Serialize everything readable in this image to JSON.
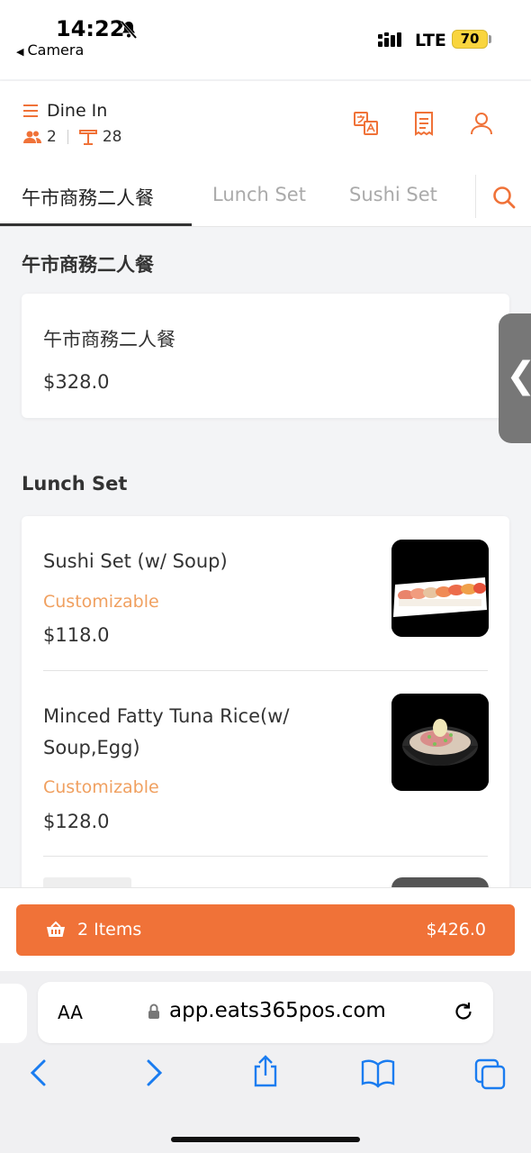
{
  "status_bar": {
    "time": "14:22",
    "back_app": "Camera",
    "network": "LTE",
    "battery": "70"
  },
  "header": {
    "mode": "Dine In",
    "guests": "2",
    "table": "28"
  },
  "tabs": [
    {
      "label": "午市商務二人餐",
      "active": true
    },
    {
      "label": "Lunch Set",
      "active": false
    },
    {
      "label": "Sushi Set",
      "active": false
    }
  ],
  "sections": [
    {
      "title": "午市商務二人餐",
      "items": [
        {
          "name": "午市商務二人餐",
          "price": "$328.0"
        }
      ]
    },
    {
      "title": "Lunch Set",
      "items": [
        {
          "name": "Sushi Set (w/ Soup)",
          "tag": "Customizable",
          "price": "$118.0",
          "image": "sushi-set-photo"
        },
        {
          "name": "Minced Fatty Tuna Rice(w/ Soup,Egg)",
          "tag": "Customizable",
          "price": "$128.0",
          "image": "tuna-rice-bowl-photo"
        }
      ]
    }
  ],
  "cart": {
    "items_label": "2 Items",
    "total": "$426.0"
  },
  "browser": {
    "text_size": "AA",
    "url": "app.eats365pos.com"
  },
  "colors": {
    "accent": "#f07238",
    "customizable": "#f0a060"
  }
}
